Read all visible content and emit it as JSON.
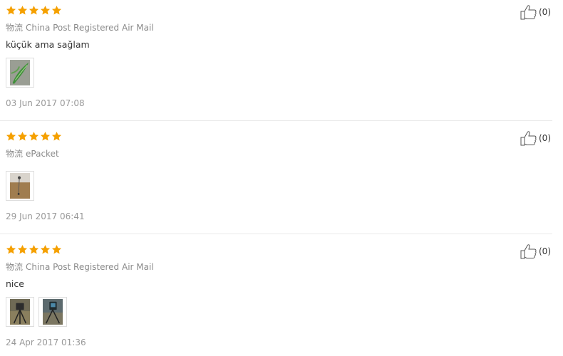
{
  "logistics_label": "物流",
  "reviews": [
    {
      "rating": 5,
      "logistics": "China Post Registered Air Mail",
      "comment": "küçük ama sağlam",
      "date": "03 Jun 2017 07:08",
      "likes": "(0)",
      "photos": [
        "green-leaf-photo"
      ]
    },
    {
      "rating": 5,
      "logistics": "ePacket",
      "comment": "",
      "date": "29 Jun 2017 06:41",
      "likes": "(0)",
      "photos": [
        "wall-photo"
      ]
    },
    {
      "rating": 5,
      "logistics": "China Post Registered Air Mail",
      "comment": "nice",
      "date": "24 Apr 2017 01:36",
      "likes": "(0)",
      "photos": [
        "tripod-photo",
        "tripod-photo"
      ]
    }
  ],
  "colors": {
    "star": "#f5a000",
    "separator": "#e9e9e9",
    "muted_text": "#999999"
  }
}
